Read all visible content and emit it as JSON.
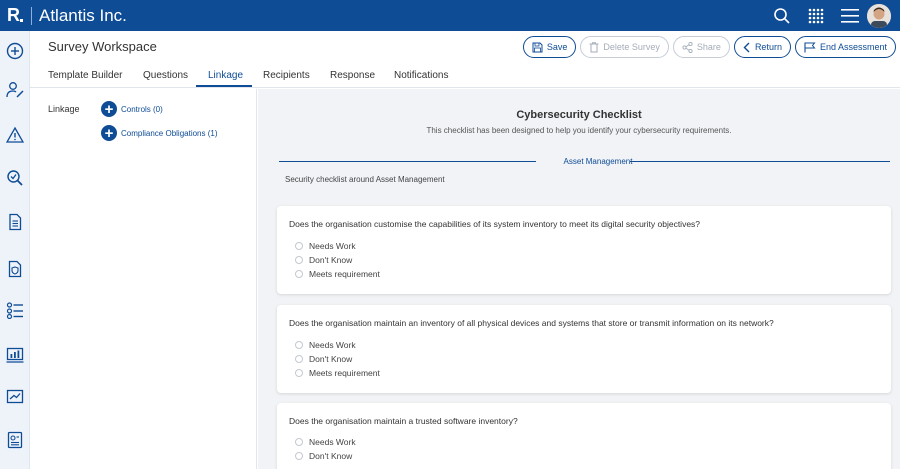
{
  "app": {
    "logo": "R",
    "title": "Atlantis Inc."
  },
  "topbar": {
    "icons": [
      "search-icon",
      "apps-grid-icon",
      "menu-icon"
    ],
    "avatar": "user-avatar"
  },
  "sidebar": {
    "icons": [
      "add-circle-icon",
      "user-edit-icon",
      "warning-icon",
      "search-check-icon",
      "document-icon",
      "shield-document-icon",
      "checklist-icon",
      "analytics-icon",
      "trend-chart-icon",
      "report-icon"
    ]
  },
  "header": {
    "title": "Survey Workspace",
    "buttons": {
      "save": "Save",
      "delete": "Delete Survey",
      "share": "Share",
      "return": "Return",
      "end": "End Assessment"
    }
  },
  "tabs": [
    "Template Builder",
    "Questions",
    "Linkage",
    "Recipients",
    "Response",
    "Notifications"
  ],
  "active_tab": "Linkage",
  "linkage": {
    "label": "Linkage",
    "items": [
      "Controls (0)",
      "Compliance Obligations (1)"
    ]
  },
  "checklist": {
    "title": "Cybersecurity Checklist",
    "description": "This checklist has been designed to help you identify your cybersecurity requirements.",
    "section": "Asset Management",
    "section_description": "Security checklist around Asset Management",
    "questions": [
      {
        "text": "Does the organisation customise the capabilities of its system inventory to meet its digital security objectives?",
        "options": [
          "Needs Work",
          "Don't Know",
          "Meets requirement"
        ]
      },
      {
        "text": "Does the organisation maintain an inventory of all physical devices and systems that store or transmit information on its network?",
        "options": [
          "Needs Work",
          "Don't Know",
          "Meets requirement"
        ]
      },
      {
        "text": "Does the organisation maintain a trusted software inventory?",
        "options": [
          "Needs Work",
          "Don't Know"
        ]
      }
    ]
  },
  "colors": {
    "brand": "#0f4c96",
    "background": "#f1f3f6"
  }
}
